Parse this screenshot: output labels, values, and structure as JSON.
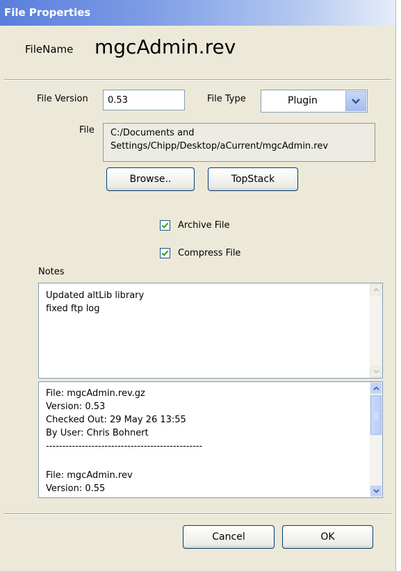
{
  "window": {
    "title": "File Properties"
  },
  "filename": {
    "label": "FileName",
    "value": "mgcAdmin.rev"
  },
  "version": {
    "label": "File Version",
    "value": "0.53"
  },
  "filetype": {
    "label": "File Type",
    "value": "Plugin"
  },
  "file": {
    "label": "File",
    "path_line1": "C:/Documents and",
    "path_line2": "Settings/Chipp/Desktop/aCurrent/mgcAdmin.rev"
  },
  "buttons": {
    "browse": "Browse..",
    "topstack": "TopStack",
    "cancel": "Cancel",
    "ok": "OK"
  },
  "checkboxes": {
    "archive": {
      "label": "Archive File",
      "checked": true
    },
    "compress": {
      "label": "Compress File",
      "checked": true
    }
  },
  "notes": {
    "label": "Notes",
    "lines": [
      "Updated altLib library",
      "fixed ftp log"
    ]
  },
  "history": {
    "lines": [
      "File: mgcAdmin.rev.gz",
      "Version: 0.53",
      "Checked Out: 29 May 26 13:55",
      "By User: Chris Bohnert",
      "------------------------------------------------",
      "",
      "File: mgcAdmin.rev",
      "Version: 0.55"
    ]
  }
}
